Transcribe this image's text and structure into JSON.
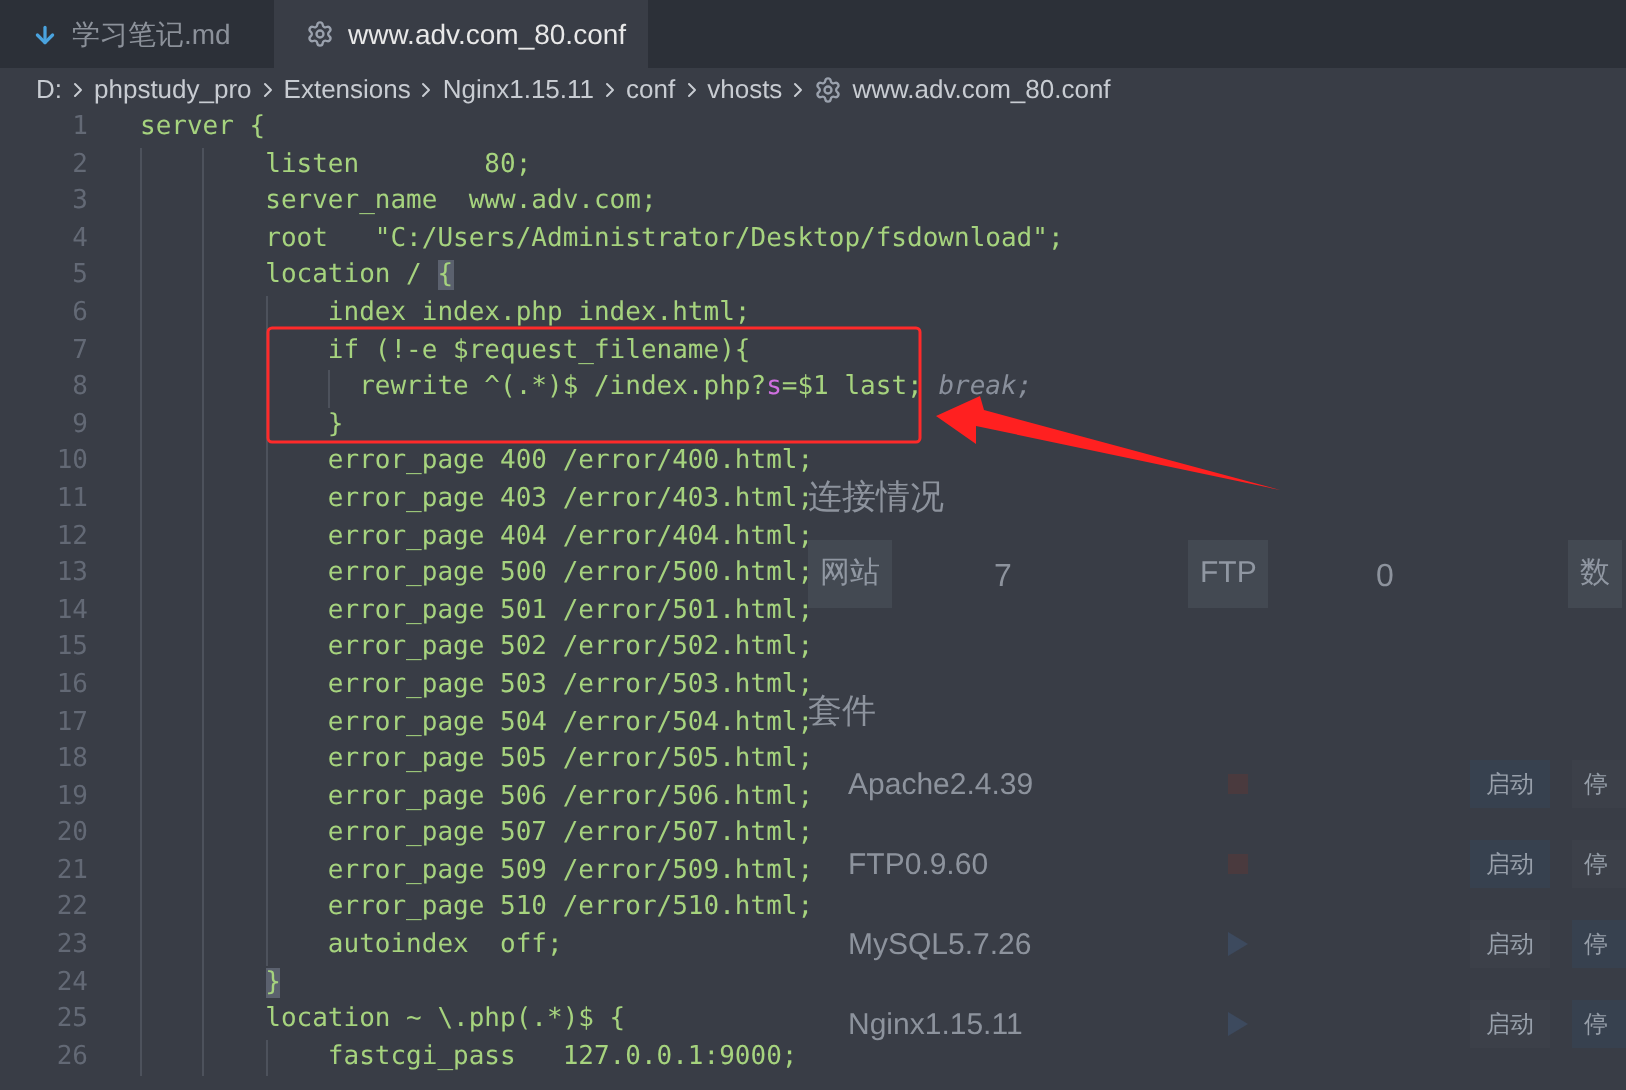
{
  "tabs": [
    {
      "label": "学习笔记.md",
      "kind": "markdown",
      "selected": false
    },
    {
      "label": "www.adv.com_80.conf",
      "kind": "config",
      "selected": true
    }
  ],
  "breadcrumb": [
    {
      "label": "D:",
      "kind": "folder"
    },
    {
      "label": "phpstudy_pro",
      "kind": "folder"
    },
    {
      "label": "Extensions",
      "kind": "folder"
    },
    {
      "label": "Nginx1.15.11",
      "kind": "folder"
    },
    {
      "label": "conf",
      "kind": "folder"
    },
    {
      "label": "vhosts",
      "kind": "folder"
    },
    {
      "label": "www.adv.com_80.conf",
      "kind": "config"
    }
  ],
  "code": {
    "lines": [
      {
        "number": "1",
        "segments": [
          {
            "text": "server {",
            "kind": "code"
          }
        ]
      },
      {
        "number": "2",
        "segments": [
          {
            "text": "        listen        80;",
            "kind": "code"
          }
        ]
      },
      {
        "number": "3",
        "segments": [
          {
            "text": "        server_name  www.adv.com;",
            "kind": "code"
          }
        ]
      },
      {
        "number": "4",
        "segments": [
          {
            "text": "        root   \"C:/Users/Administrator/Desktop/fsdownload\";",
            "kind": "code"
          }
        ]
      },
      {
        "number": "5",
        "segments": [
          {
            "text": "        location / ",
            "kind": "code"
          },
          {
            "text": "{",
            "kind": "bracket"
          }
        ]
      },
      {
        "number": "6",
        "segments": [
          {
            "text": "            index index.php index.html;",
            "kind": "code"
          }
        ]
      },
      {
        "number": "7",
        "segments": [
          {
            "text": "            if (!-e $request_filename){",
            "kind": "code"
          }
        ]
      },
      {
        "number": "8",
        "segments": [
          {
            "text": "              rewrite ^(.*)$ /index.php?",
            "kind": "code"
          },
          {
            "text": "s",
            "kind": "param"
          },
          {
            "text": "=$1 last; ",
            "kind": "code"
          },
          {
            "text": "break;",
            "kind": "comment"
          }
        ]
      },
      {
        "number": "9",
        "segments": [
          {
            "text": "            }",
            "kind": "code"
          }
        ]
      },
      {
        "number": "10",
        "segments": [
          {
            "text": "            error_page 400 /error/400.html;",
            "kind": "code"
          }
        ]
      },
      {
        "number": "11",
        "segments": [
          {
            "text": "            error_page 403 /error/403.html;",
            "kind": "code"
          }
        ]
      },
      {
        "number": "12",
        "segments": [
          {
            "text": "            error_page 404 /error/404.html;",
            "kind": "code"
          }
        ]
      },
      {
        "number": "13",
        "segments": [
          {
            "text": "            error_page 500 /error/500.html;",
            "kind": "code"
          }
        ]
      },
      {
        "number": "14",
        "segments": [
          {
            "text": "            error_page 501 /error/501.html;",
            "kind": "code"
          }
        ]
      },
      {
        "number": "15",
        "segments": [
          {
            "text": "            error_page 502 /error/502.html;",
            "kind": "code"
          }
        ]
      },
      {
        "number": "16",
        "segments": [
          {
            "text": "            error_page 503 /error/503.html;",
            "kind": "code"
          }
        ]
      },
      {
        "number": "17",
        "segments": [
          {
            "text": "            error_page 504 /error/504.html;",
            "kind": "code"
          }
        ]
      },
      {
        "number": "18",
        "segments": [
          {
            "text": "            error_page 505 /error/505.html;",
            "kind": "code"
          }
        ]
      },
      {
        "number": "19",
        "segments": [
          {
            "text": "            error_page 506 /error/506.html;",
            "kind": "code"
          }
        ]
      },
      {
        "number": "20",
        "segments": [
          {
            "text": "            error_page 507 /error/507.html;",
            "kind": "code"
          }
        ]
      },
      {
        "number": "21",
        "segments": [
          {
            "text": "            error_page 509 /error/509.html;",
            "kind": "code"
          }
        ]
      },
      {
        "number": "22",
        "segments": [
          {
            "text": "            error_page 510 /error/510.html;",
            "kind": "code"
          }
        ]
      },
      {
        "number": "23",
        "segments": [
          {
            "text": "            autoindex  off;",
            "kind": "code"
          }
        ]
      },
      {
        "number": "24",
        "segments": [
          {
            "text": "        }",
            "kind": "bracket"
          }
        ]
      },
      {
        "number": "25",
        "segments": [
          {
            "text": "        location ~ \\.php(.*)$ {",
            "kind": "code"
          }
        ]
      },
      {
        "number": "26",
        "segments": [
          {
            "text": "            fastcgi_pass   127.0.0.1:9000;",
            "kind": "code"
          }
        ]
      }
    ]
  },
  "background_window": {
    "connections": {
      "title": "连接情况",
      "stats": [
        {
          "label": "网站",
          "value": "7"
        },
        {
          "label": "FTP",
          "value": "0"
        },
        {
          "label": "数"
        }
      ]
    },
    "suite": {
      "title": "套件",
      "services": [
        {
          "name": "Apache2.4.39",
          "running": false,
          "start": "启动",
          "stop": "停"
        },
        {
          "name": "FTP0.9.60",
          "running": false,
          "start": "启动",
          "stop": "停"
        },
        {
          "name": "MySQL5.7.26",
          "running": true,
          "start": "启动",
          "stop": "停"
        },
        {
          "name": "Nginx1.15.11",
          "running": true,
          "start": "启动",
          "stop": "停"
        }
      ]
    }
  }
}
